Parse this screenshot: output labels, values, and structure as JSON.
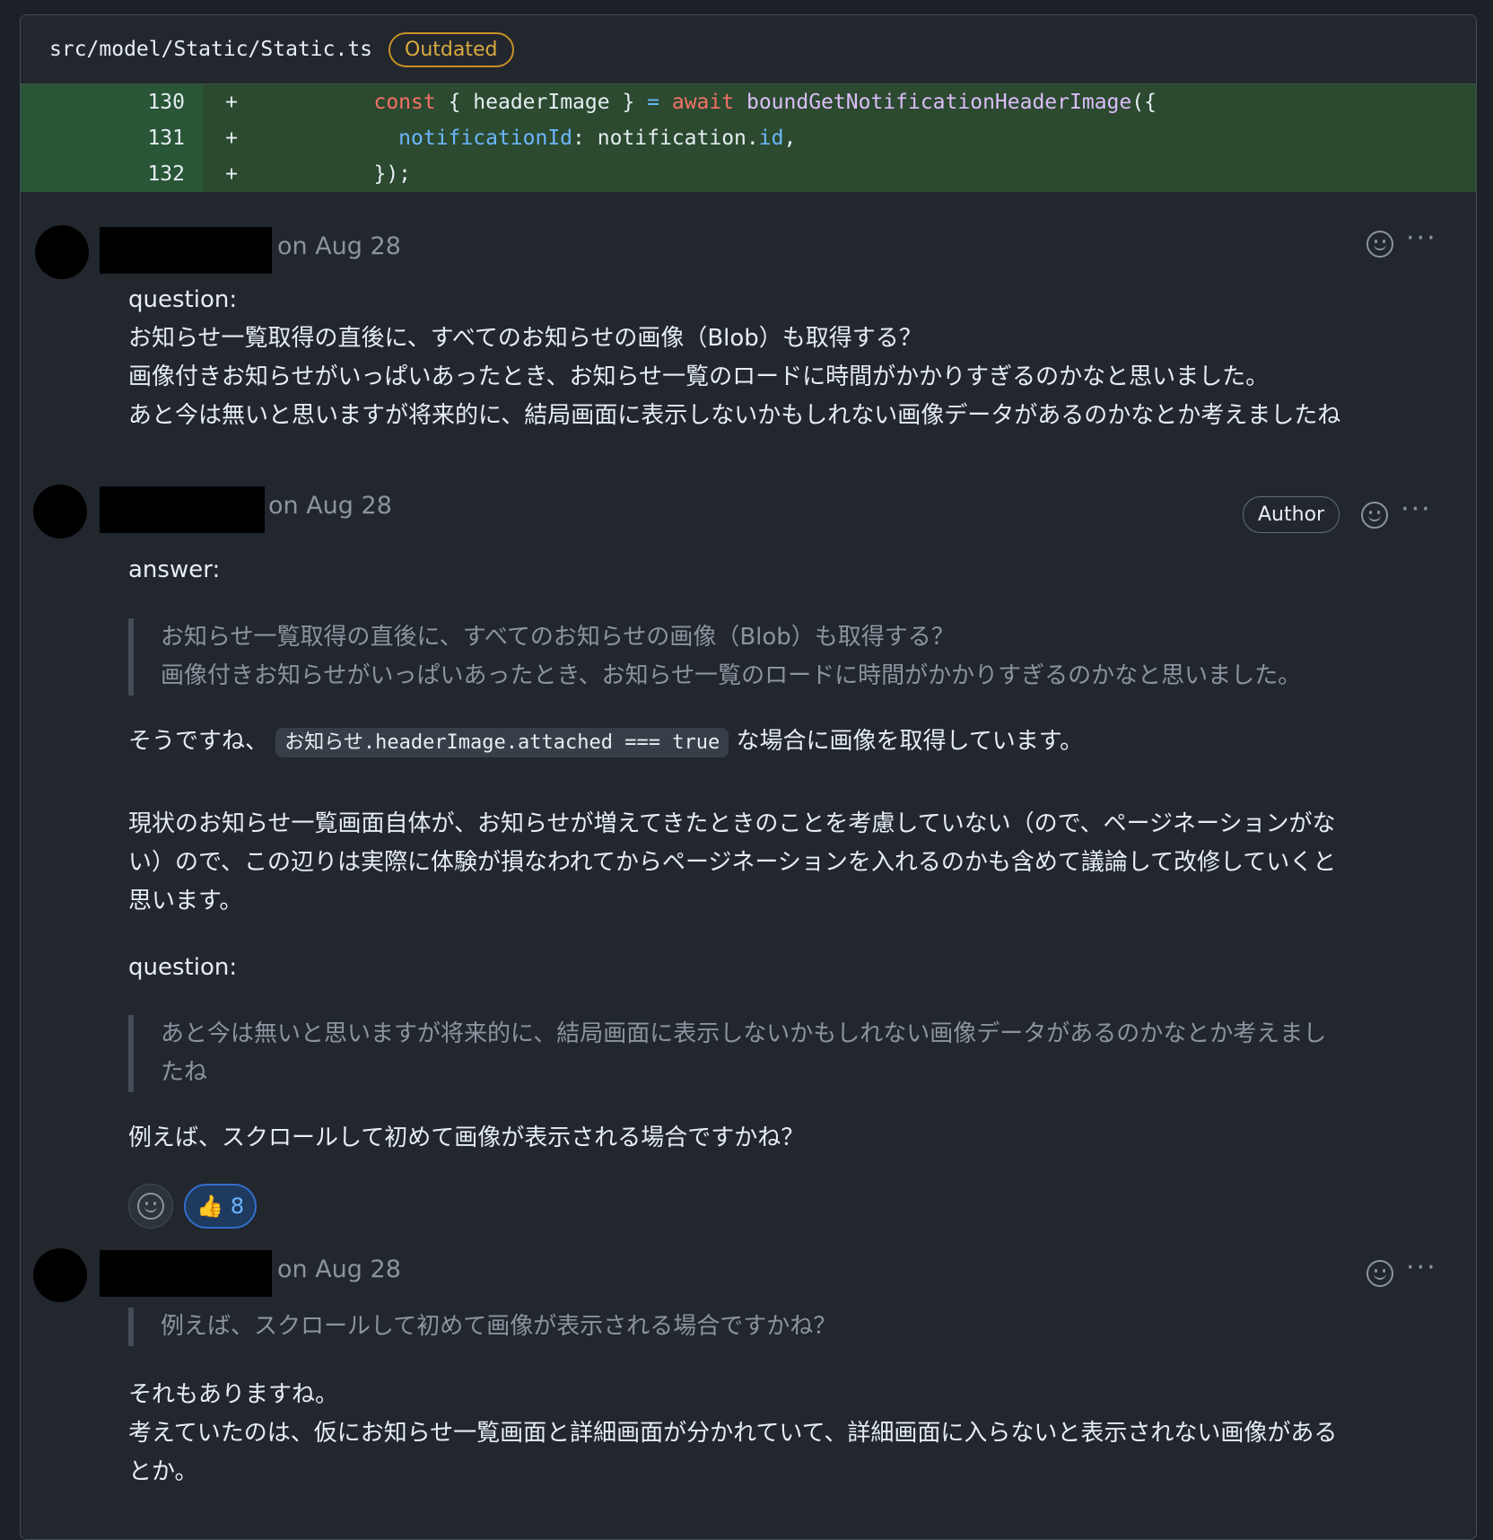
{
  "file": {
    "path": "src/model/Static/Static.ts",
    "badge": "Outdated"
  },
  "diff": [
    {
      "num": "130",
      "sign": "+",
      "indent": "          ",
      "parts": [
        {
          "t": "kw",
          "v": "const"
        },
        {
          "t": "",
          "v": " { headerImage } "
        },
        {
          "t": "prop",
          "v": "="
        },
        {
          "t": "",
          "v": " "
        },
        {
          "t": "kw",
          "v": "await"
        },
        {
          "t": "",
          "v": " "
        },
        {
          "t": "fn",
          "v": "boundGetNotificationHeaderImage"
        },
        {
          "t": "",
          "v": "({"
        }
      ]
    },
    {
      "num": "131",
      "sign": "+",
      "indent": "            ",
      "parts": [
        {
          "t": "prop",
          "v": "notificationId"
        },
        {
          "t": "",
          "v": ": notification."
        },
        {
          "t": "prop",
          "v": "id"
        },
        {
          "t": "",
          "v": ","
        }
      ]
    },
    {
      "num": "132",
      "sign": "+",
      "indent": "          ",
      "parts": [
        {
          "t": "",
          "v": "});"
        }
      ]
    }
  ],
  "comments": [
    {
      "date": "on Aug 28",
      "lines": [
        "question:",
        "お知らせ一覧取得の直後に、すべてのお知らせの画像（Blob）も取得する？",
        "画像付きお知らせがいっぱいあったとき、お知らせ一覧のロードに時間がかかりすぎるのかなと思いました。",
        "あと今は無いと思いますが将来的に、結局画面に表示しないかもしれない画像データがあるのかなとか考えましたね"
      ]
    },
    {
      "date": "on Aug 28",
      "badge": "Author",
      "answer_label": "answer:",
      "quote1": [
        "お知らせ一覧取得の直後に、すべてのお知らせの画像（Blob）も取得する？",
        "画像付きお知らせがいっぱいあったとき、お知らせ一覧のロードに時間がかかりすぎるのかなと思いました。"
      ],
      "p1_before": "そうですね、",
      "p1_code": "お知らせ.headerImage.attached === true",
      "p1_after": "な場合に画像を取得しています。",
      "p2": [
        "現状のお知らせ一覧画面自体が、お知らせが増えてきたときのことを考慮していない（ので、ページネーションがな",
        "い）ので、この辺りは実際に体験が損なわれてからページネーションを入れるのかも含めて議論して改修していくと",
        "思います。"
      ],
      "question_label": "question:",
      "quote2": [
        "あと今は無いと思いますが将来的に、結局画面に表示しないかもしれない画像データがあるのかなとか考えまし",
        "たね"
      ],
      "p3": "例えば、スクロールして初めて画像が表示される場合ですかね？",
      "reaction": {
        "icon": "👍",
        "count": "8"
      }
    },
    {
      "date": "on Aug 28",
      "quote": "例えば、スクロールして初めて画像が表示される場合ですかね？",
      "lines": [
        "それもありますね。",
        "考えていたのは、仮にお知らせ一覧画面と詳細画面が分かれていて、詳細画面に入らないと表示されない画像がある",
        "とか。"
      ]
    }
  ],
  "actions": {
    "more": "···"
  }
}
